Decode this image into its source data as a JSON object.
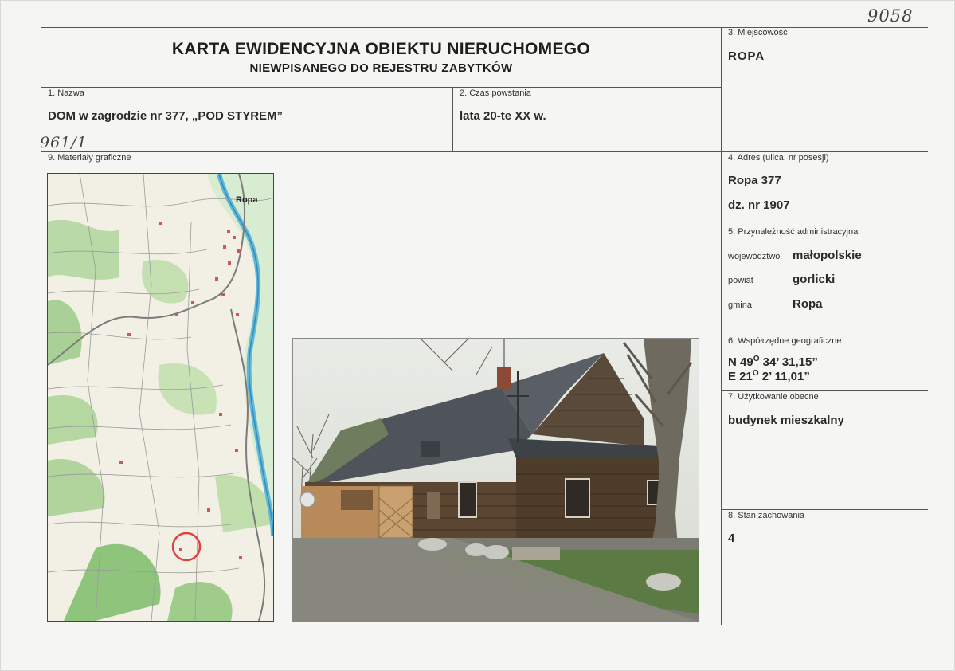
{
  "handwritten": {
    "top_number": "9058",
    "side_number": "961/1"
  },
  "header": {
    "title": "KARTA EWIDENCYJNA OBIEKTU NIERUCHOMEGO",
    "subtitle": "NIEWPISANEGO DO REJESTRU ZABYTKÓW"
  },
  "fields": {
    "nazwa": {
      "label": "1. Nazwa",
      "value": "DOM w zagrodzie nr 377, „POD STYREM”"
    },
    "czas": {
      "label": "2. Czas powstania",
      "value": "lata 20-te XX w."
    },
    "miejscowosc": {
      "label": "3. Miejscowość",
      "value": "ROPA"
    },
    "adres": {
      "label": "4. Adres (ulica, nr posesji)",
      "line1": "Ropa 377",
      "line2": "dz. nr 1907"
    },
    "admin": {
      "label": "5. Przynależność administracyjna",
      "wojewodztwo_label": "województwo",
      "wojewodztwo": "małopolskie",
      "powiat_label": "powiat",
      "powiat": "gorlicki",
      "gmina_label": "gmina",
      "gmina": "Ropa"
    },
    "geo": {
      "label": "6. Współrzędne geograficzne",
      "n_prefix": "N 49",
      "n_deg": "O",
      "n_rest": " 34’ 31,15”",
      "e_prefix": "E 21",
      "e_deg": "O",
      "e_rest": " 2’ 11,01”"
    },
    "uzytkowanie": {
      "label": "7. Użytkowanie obecne",
      "value": "budynek mieszkalny"
    },
    "stan": {
      "label": "8. Stan zachowania",
      "value": "4"
    },
    "materialy": {
      "label": "9. Materiały graficzne"
    }
  },
  "map": {
    "place_label": "Ropa",
    "marker_color": "#e04040"
  }
}
